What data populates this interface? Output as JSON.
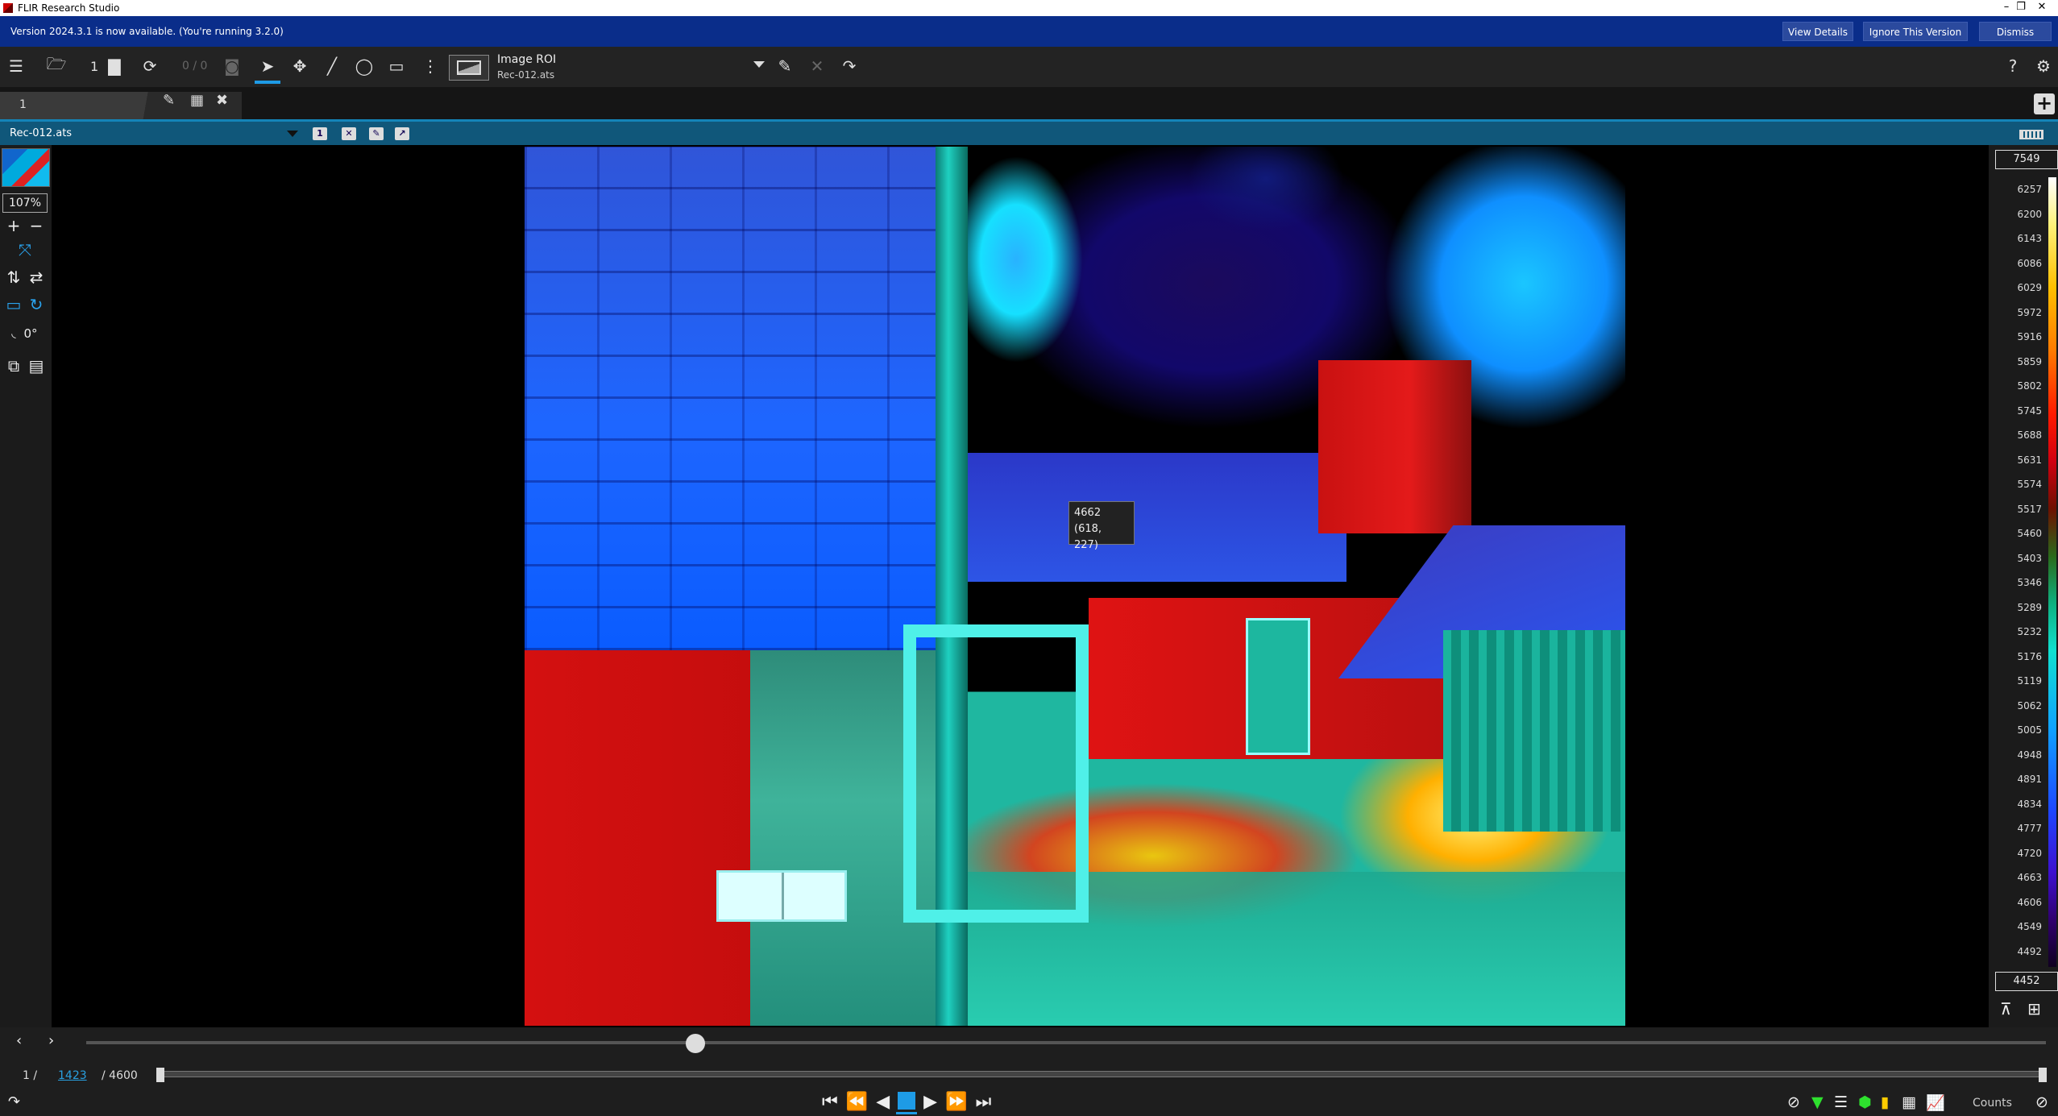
{
  "window": {
    "title": "FLIR Research Studio",
    "controls": {
      "minimize": "–",
      "maximize": "❐",
      "close": "✕"
    }
  },
  "update_banner": {
    "message": "Version 2024.3.1 is now available. (You're running 3.2.0)",
    "buttons": {
      "view_details": "View Details",
      "ignore": "Ignore This Version",
      "dismiss": "Dismiss"
    }
  },
  "toolbar": {
    "recording_count": "1",
    "snapshot_counter": "0 / 0",
    "roi": {
      "title": "Image ROI",
      "file": "Rec-012.ats"
    },
    "help": "?"
  },
  "tabs": {
    "active_label": "1"
  },
  "file_row": {
    "filename": "Rec-012.ats",
    "badge": "1"
  },
  "left_panel": {
    "zoom": "107%",
    "rotation": "0°"
  },
  "viewer": {
    "tooltip_value": "4662",
    "tooltip_coords": "(618, 227)"
  },
  "color_scale": {
    "max": "7549",
    "min": "4452",
    "ticks": [
      "6257",
      "6200",
      "6143",
      "6086",
      "6029",
      "5972",
      "5916",
      "5859",
      "5802",
      "5745",
      "5688",
      "5631",
      "5574",
      "5517",
      "5460",
      "5403",
      "5346",
      "5289",
      "5232",
      "5176",
      "5119",
      "5062",
      "5005",
      "4948",
      "4891",
      "4834",
      "4777",
      "4720",
      "4663",
      "4606",
      "4549",
      "4492"
    ]
  },
  "playback": {
    "range_start": "1 /",
    "current_frame": "1423",
    "total_frames": "/ 4600",
    "units_label": "Counts"
  },
  "colors": {
    "accent": "#1e9be6",
    "banner": "#0a2d8a",
    "file_row": "#10577a"
  }
}
